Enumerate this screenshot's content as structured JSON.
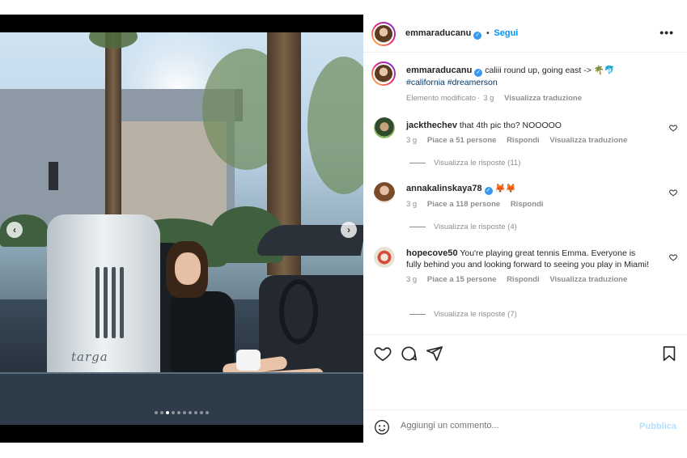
{
  "post": {
    "author": "emmaraducanu",
    "follow_label": "Segui",
    "more_label": "•••",
    "verified_mark": "✓",
    "caption_text": "caliii round up, going east ->",
    "caption_emojis": "🌴🐬",
    "hashtag_1": "#california",
    "hashtag_2": "#dreamerson",
    "edited_label": "Elemento modificato",
    "time": "3 g",
    "translate_label": "Visualizza traduzione"
  },
  "comments": [
    {
      "username": "jackthechev",
      "text": "that 4th pic tho? NOOOOO",
      "time": "3 g",
      "likes": "Piace a 51 persone",
      "reply": "Rispondi",
      "translate": "Visualizza traduzione",
      "view_replies": "Visualizza le risposte (11)"
    },
    {
      "username": "annakalinskaya78",
      "text": "🦊🦊",
      "time": "3 g",
      "likes": "Piace a 118 persone",
      "reply": "Rispondi",
      "view_replies": "Visualizza le risposte (4)"
    },
    {
      "username": "hopecove50",
      "text": "You're playing great tennis Emma. Everyone is fully behind you and looking forward to seeing you play in Miami!",
      "time": "3 g",
      "likes": "Piace a 15 persone",
      "reply": "Rispondi",
      "translate": "Visualizza traduzione",
      "view_replies": "Visualizza le risposte (7)"
    }
  ],
  "carousel": {
    "prev_icon": "chevron-left-icon",
    "next_icon": "chevron-right-icon",
    "dot_count": 10,
    "active_index": 2,
    "car_badge_text": "targa"
  },
  "add_comment": {
    "placeholder": "Aggiungi un commento...",
    "publish_label": "Pubblica"
  },
  "colors": {
    "accent": "#0095f6",
    "verified": "#3897f0",
    "publish_disabled": "#b2dffc"
  }
}
